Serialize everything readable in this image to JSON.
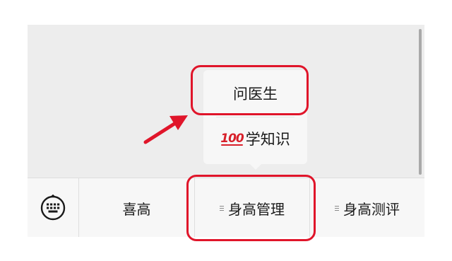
{
  "popup": {
    "items": [
      {
        "label": "问医生"
      },
      {
        "icon": "hundred-points-emoji",
        "emoji_text": "💯",
        "label": "学知识"
      }
    ]
  },
  "menubar": {
    "keyboard_icon": "keyboard-icon",
    "tabs": [
      {
        "label": "喜高",
        "has_submenu": false
      },
      {
        "label": "身高管理",
        "has_submenu": true
      },
      {
        "label": "身高测评",
        "has_submenu": true
      }
    ]
  },
  "colors": {
    "highlight": "#e0152a",
    "screen_bg": "#ededed",
    "bar_bg": "#f7f7f7"
  }
}
